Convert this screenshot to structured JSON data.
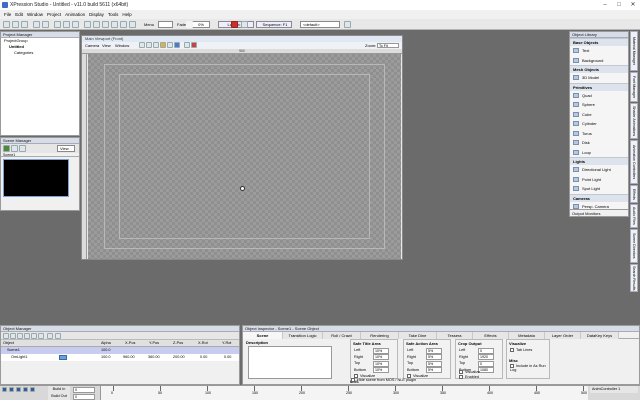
{
  "window": {
    "title": "XPression Studio - Untitled - v11.0 build 5611 (x64bit)"
  },
  "menu": [
    "File",
    "Edit",
    "Window",
    "Project",
    "Animation",
    "Display",
    "Tools",
    "Help"
  ],
  "toolbar": {
    "menu_label": "Menu",
    "fade_label": "Fade",
    "fade_value": "0%",
    "layout_label": "Layout: F1",
    "sequence_label": "Sequence: F1",
    "default_value": "<default>"
  },
  "project_manager": {
    "header": "Project Manager",
    "items": [
      "ProjectGroup",
      "Untitled",
      "Categories"
    ]
  },
  "scene_manager": {
    "header": "Scene Manager",
    "view_label": "View",
    "scene_name": "Scene1"
  },
  "viewport": {
    "title": "Main Viewport (Front)",
    "menu": [
      "Camera",
      "View",
      "Window"
    ],
    "zoom_label": "Zoom:",
    "zoom_value": "To Fit",
    "ruler_mid": "960"
  },
  "object_library": {
    "header": "Object Library",
    "groups": [
      {
        "name": "Base Objects",
        "items": [
          "Text",
          "Background"
        ]
      },
      {
        "name": "Mesh Objects",
        "items": [
          "3D Model"
        ]
      },
      {
        "name": "Primitives",
        "items": [
          "Quad",
          "Sphere",
          "Cube",
          "Cylinder",
          "Torus",
          "Disk",
          "Loop"
        ]
      },
      {
        "name": "Lights",
        "items": [
          "Directional Light",
          "Point Light",
          "Spot Light"
        ]
      },
      {
        "name": "Cameras",
        "items": [
          "Persp. Camera"
        ]
      }
    ],
    "output_monitors": "Output Monitors"
  },
  "side_tabs": [
    "Material Manager",
    "Font Manager",
    "Shader Animations",
    "Animation Controllers",
    "Effects",
    "Audio Files",
    "Scene Directors",
    "Search Results"
  ],
  "object_manager": {
    "header": "Object Manager",
    "columns": [
      "Object",
      "Alpha",
      "X-Pos",
      "Y-Pos",
      "Z-Pos",
      "X-Rot",
      "Y-Rot"
    ],
    "rows": [
      {
        "name": "Scene1",
        "alpha": "100.0",
        "x": "",
        "y": "",
        "z": "",
        "xr": "",
        "yr": ""
      },
      {
        "name": "OmLight1",
        "alpha": "100.0",
        "x": "960.00",
        "y": "360.00",
        "z": "200.00",
        "xr": "0.00",
        "yr": "0.00"
      }
    ]
  },
  "inspector": {
    "header": "Object Inspector - Scene1 - Scene Object",
    "tabs": [
      "Scene",
      "Transition Logic",
      "Roll / Crawl",
      "Rendering",
      "Take Dine",
      "Tessera",
      "Effects",
      "Metadata",
      "Layer Order",
      "DataKey Keys"
    ],
    "description_label": "Description",
    "safe_title": {
      "title": "Safe Title Area",
      "rows": [
        [
          "Left",
          "10%"
        ],
        [
          "Right",
          "10%"
        ],
        [
          "Top",
          "10%"
        ],
        [
          "Bottom",
          "10%"
        ]
      ],
      "visualize": "Visualize"
    },
    "safe_action": {
      "title": "Safe Action Area",
      "rows": [
        [
          "Left",
          "5%"
        ],
        [
          "Right",
          "5%"
        ],
        [
          "Top",
          "5%"
        ],
        [
          "Bottom",
          "5%"
        ]
      ],
      "visualize": "Visualize"
    },
    "crop": {
      "title": "Crop Output",
      "rows": [
        [
          "Left",
          "0"
        ],
        [
          "Right",
          "1920"
        ],
        [
          "Top",
          "0"
        ],
        [
          "Bottom",
          "1080"
        ]
      ],
      "visualize": "Visualize",
      "enabled": "Enabled"
    },
    "visualize_group": {
      "title": "Visualize",
      "tab_lines": "Tab Lines"
    },
    "misc": {
      "title": "Misc",
      "include": "Include in As Run Log"
    },
    "mos": {
      "title": "MOS",
      "hide": "Hide scene from MOS / NLE plugin"
    }
  },
  "timeline": {
    "build_in": "Build In",
    "build_out": "Build Out",
    "in_value": "0",
    "out_value": "0",
    "ticks": [
      "0",
      "50",
      "100",
      "150",
      "200",
      "250",
      "300",
      "350",
      "400",
      "450",
      "500"
    ],
    "anim_controller": "AnimController 1"
  }
}
